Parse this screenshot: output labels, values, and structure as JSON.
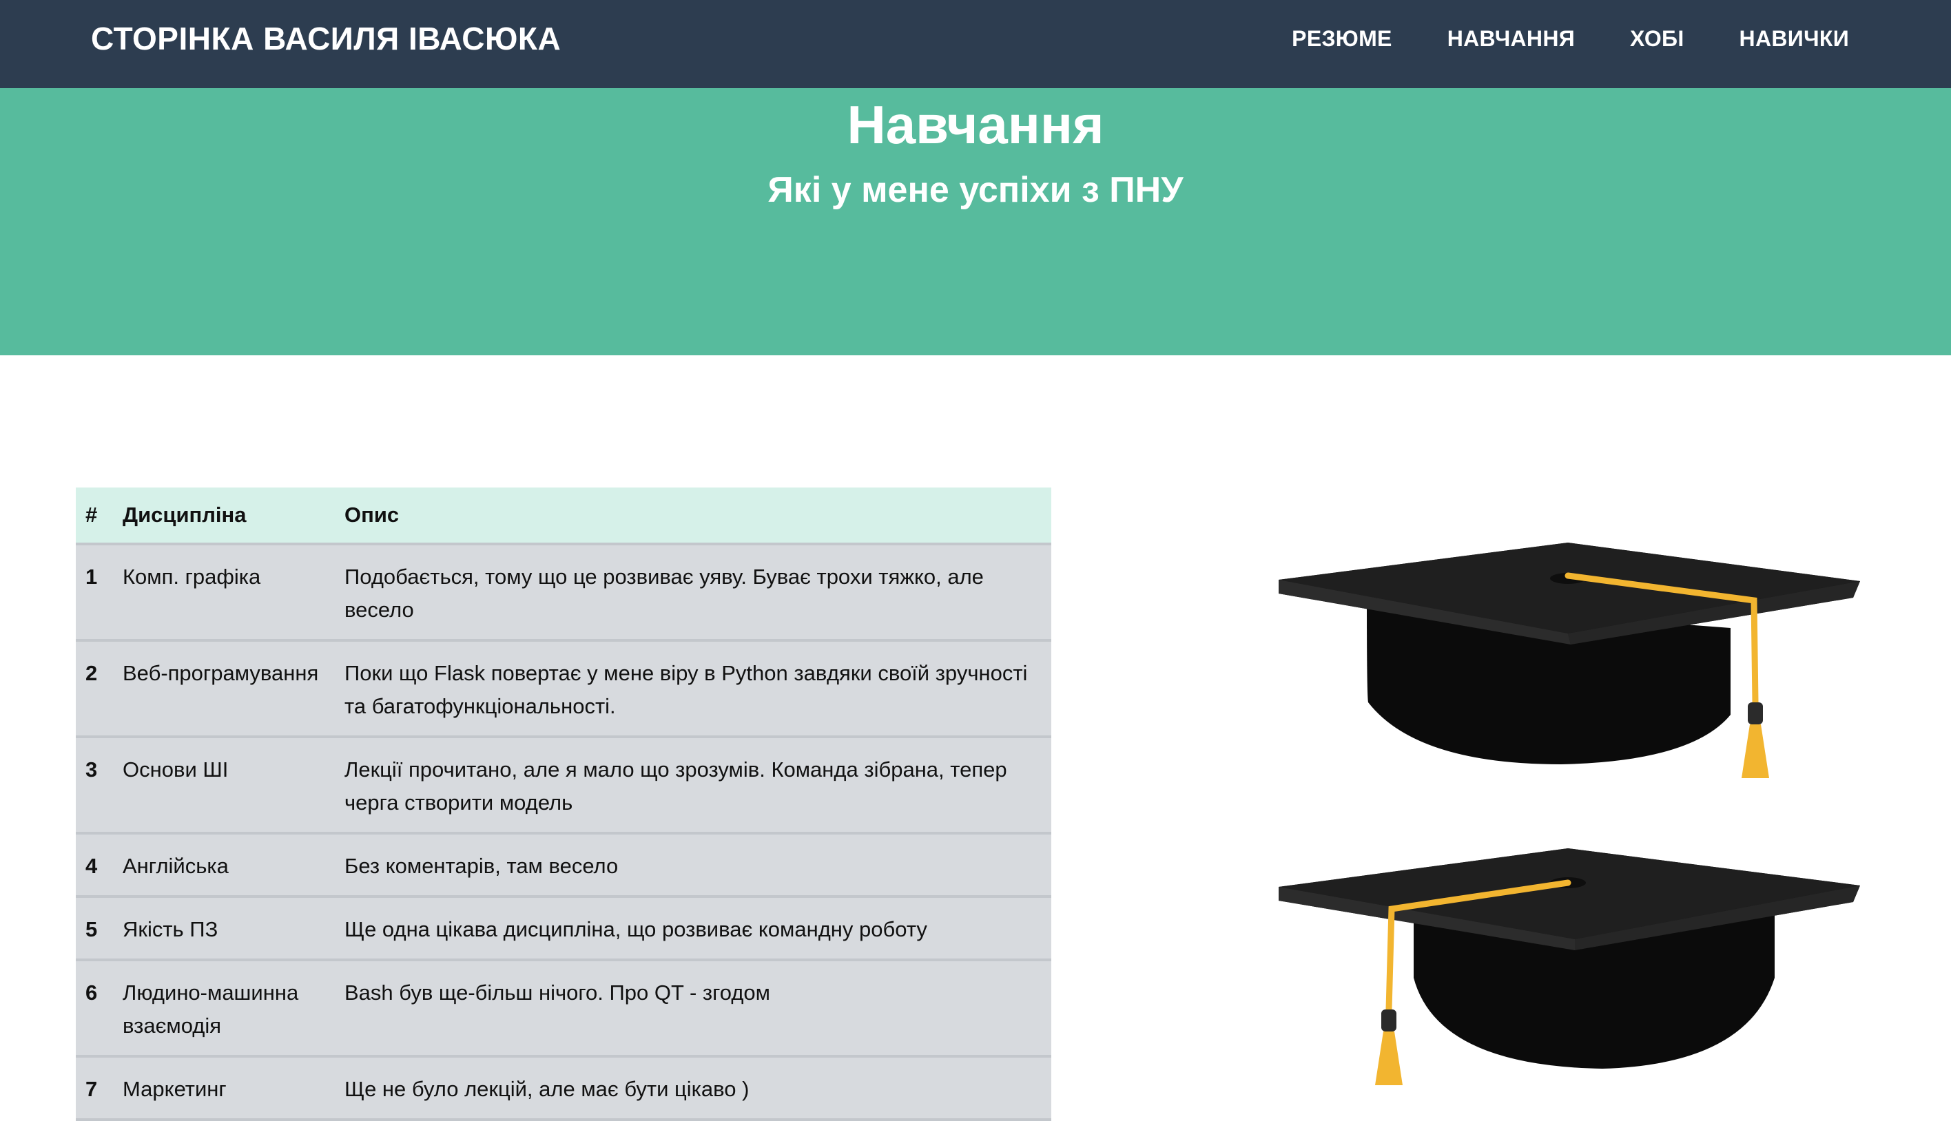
{
  "navbar": {
    "brand": "СТОРІНКА ВАСИЛЯ ІВАСЮКА",
    "links": [
      "РЕЗЮМЕ",
      "НАВЧАННЯ",
      "ХОБІ",
      "НАВИЧКИ"
    ]
  },
  "masthead": {
    "title": "Навчання",
    "subtitle": "Які у мене успіхи з ПНУ"
  },
  "table": {
    "headers": [
      "#",
      "Дисципліна",
      "Опис"
    ],
    "rows": [
      {
        "num": "1",
        "discipline": "Комп. графіка",
        "description": "Подобається, тому що це розвиває уяву. Буває трохи тяжко, але весело"
      },
      {
        "num": "2",
        "discipline": "Веб-програмування",
        "description": "Поки що Flask повертає у мене віру в Python завдяки своїй зручності та багатофункціональності."
      },
      {
        "num": "3",
        "discipline": "Основи ШІ",
        "description": "Лекції прочитано, але я мало що зрозумів. Команда зібрана, тепер черга створити модель"
      },
      {
        "num": "4",
        "discipline": "Англійська",
        "description": "Без коментарів, там весело"
      },
      {
        "num": "5",
        "discipline": "Якість ПЗ",
        "description": "Ще одна цікава дисципліна, що розвиває командну роботу"
      },
      {
        "num": "6",
        "discipline": "Людино-машинна взаємодія",
        "description": "Bash був ще-більш нічого. Про QT - згодом"
      },
      {
        "num": "7",
        "discipline": "Маркетинг",
        "description": "Ще не було лекцій, але має бути цікаво )"
      }
    ]
  },
  "colors": {
    "navbar": "#2d3d50",
    "masthead": "#57bb9d",
    "table_header": "#d6f1e9",
    "table_row": "#d7dade",
    "tassel": "#f2b530"
  },
  "illustration": {
    "icons": [
      "graduation-cap-icon",
      "graduation-cap-icon"
    ]
  }
}
